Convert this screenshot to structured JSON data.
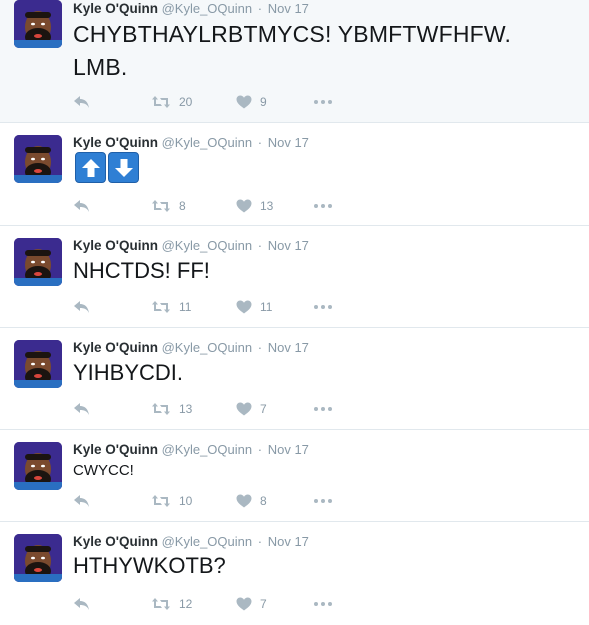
{
  "tweets": [
    {
      "name": "Kyle O'Quinn",
      "handle": "@Kyle_OQuinn",
      "separator": "·",
      "date": "Nov 17",
      "text_lines": [
        "CHYBTHAYLRBTMYCS! YBMFTWFHFW.",
        "LMB."
      ],
      "retweets": "20",
      "likes": "9"
    },
    {
      "name": "Kyle O'Quinn",
      "handle": "@Kyle_OQuinn",
      "separator": "·",
      "date": "Nov 17",
      "emojis": [
        "up-arrow-emoji",
        "down-arrow-emoji"
      ],
      "retweets": "8",
      "likes": "13"
    },
    {
      "name": "Kyle O'Quinn",
      "handle": "@Kyle_OQuinn",
      "separator": "·",
      "date": "Nov 17",
      "text": "NHCTDS! FF!",
      "retweets": "11",
      "likes": "11"
    },
    {
      "name": "Kyle O'Quinn",
      "handle": "@Kyle_OQuinn",
      "separator": "·",
      "date": "Nov 17",
      "text": "YIHBYCDI.",
      "retweets": "13",
      "likes": "7"
    },
    {
      "name": "Kyle O'Quinn",
      "handle": "@Kyle_OQuinn",
      "separator": "·",
      "date": "Nov 17",
      "text": "CWYCC!",
      "retweets": "10",
      "likes": "8"
    },
    {
      "name": "Kyle O'Quinn",
      "handle": "@Kyle_OQuinn",
      "separator": "·",
      "date": "Nov 17",
      "text": "HTHYWKOTB?",
      "retweets": "12",
      "likes": "7"
    }
  ],
  "icons": {
    "reply": "reply-icon",
    "retweet": "retweet-icon",
    "like": "heart-icon",
    "more": "more-options-icon"
  },
  "colors": {
    "name": "#292f33",
    "meta": "#8899a6",
    "action_icon": "#aab8c2",
    "divider": "#e1e8ed",
    "highlight_bg": "#f5f8fa",
    "avatar_bg": "#3b2b8f",
    "emoji_blue": "#2f7fd4"
  }
}
